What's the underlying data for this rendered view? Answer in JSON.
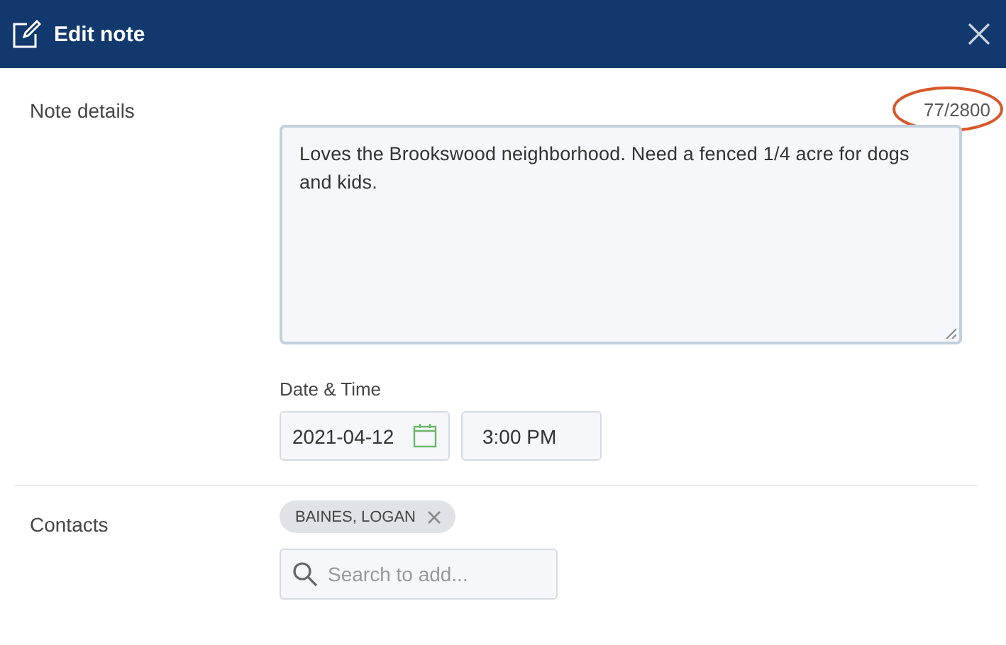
{
  "window": {
    "title": "Edit note"
  },
  "note": {
    "label": "Note details",
    "counter": "77/2800",
    "counter_circled": true,
    "value": "Loves the Brookswood neighborhood. Need a fenced 1/4 acre for dogs and kids."
  },
  "datetime": {
    "label": "Date & Time",
    "date": "2021-04-12",
    "time": "3:00 PM"
  },
  "contacts": {
    "label": "Contacts",
    "chips": [
      "BAINES, LOGAN"
    ],
    "search": {
      "placeholder": "Search to add..."
    }
  }
}
